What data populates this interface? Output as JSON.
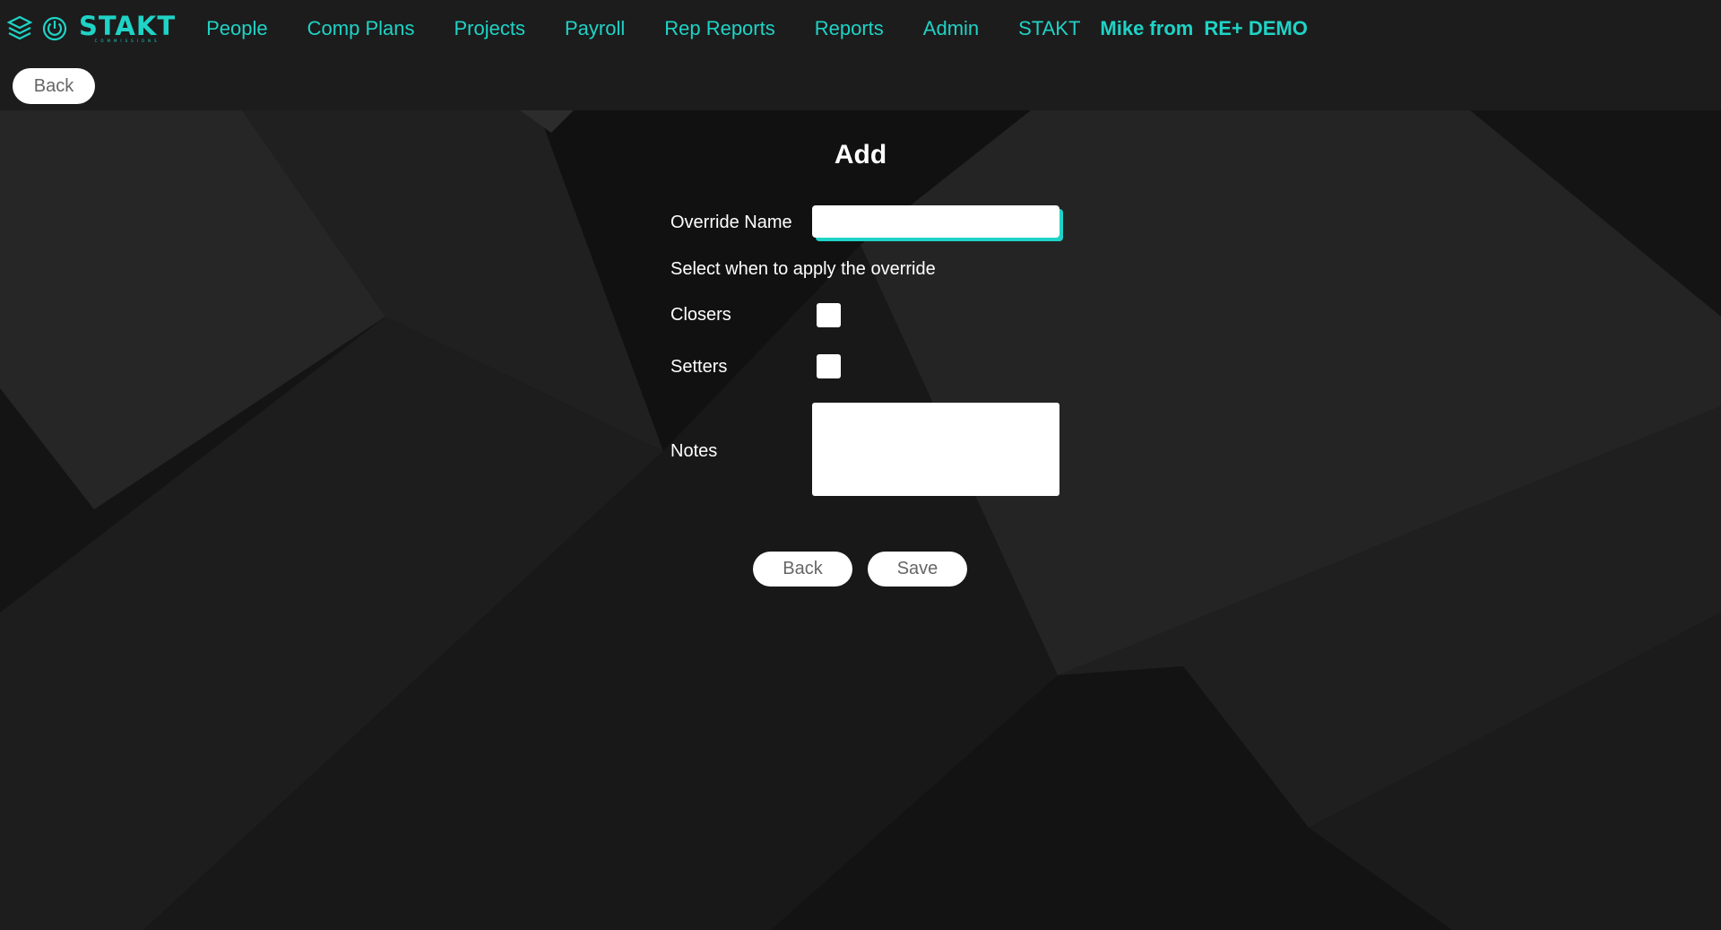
{
  "nav": {
    "brand": "STAKT",
    "brand_sub": "COMMISSIONS",
    "items": [
      {
        "label": "People"
      },
      {
        "label": "Comp Plans"
      },
      {
        "label": "Projects"
      },
      {
        "label": "Payroll"
      },
      {
        "label": "Rep Reports"
      },
      {
        "label": "Reports"
      },
      {
        "label": "Admin"
      },
      {
        "label": "STAKT"
      }
    ],
    "user": {
      "prefix": "Mike from",
      "org": "RE+ DEMO"
    },
    "back_label": "Back"
  },
  "form": {
    "title": "Add",
    "override_name_label": "Override Name",
    "override_name_value": "",
    "apply_prompt": "Select when to apply the override",
    "closers_label": "Closers",
    "setters_label": "Setters",
    "notes_label": "Notes",
    "notes_value": "",
    "back_label": "Back",
    "save_label": "Save"
  },
  "colors": {
    "accent": "#1fd3c6",
    "header_bg": "#1c1c1c",
    "page_bg": "#151515"
  }
}
